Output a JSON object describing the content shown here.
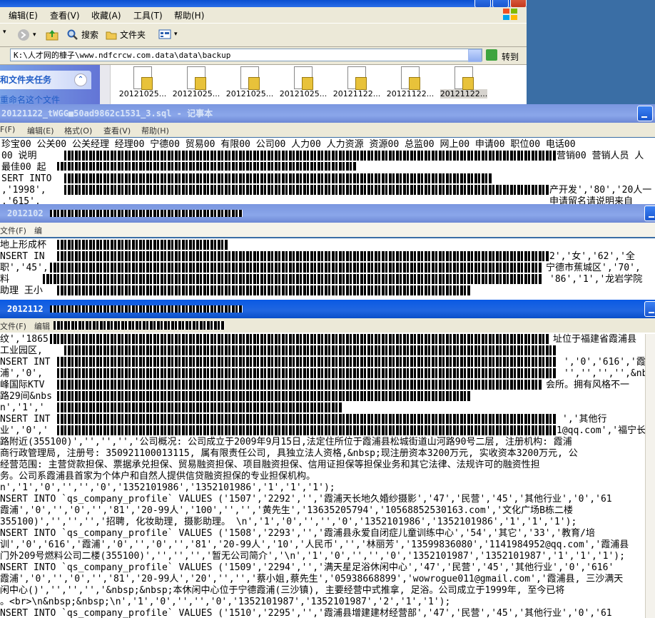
{
  "explorer": {
    "menu": [
      "编辑(E)",
      "查看(V)",
      "收藏(A)",
      "工具(T)",
      "帮助(H)"
    ],
    "toolbar": {
      "search": "搜索",
      "folders": "文件夹"
    },
    "address": "K:\\人才网的槺子\\www.ndfcrcw.com.data\\data\\backup",
    "go": "转到",
    "task_header": "和文件夹任务",
    "task_link": "重命名这个文件",
    "files": [
      "20121025...",
      "20121025...",
      "20121025...",
      "20121025...",
      "20121122...",
      "20121122...",
      "20121122..."
    ]
  },
  "notepad1": {
    "title": "20121122_tWGG■50ad9862c1531_3.sql - 记事本",
    "menu": [
      "F(F)",
      "编辑(E)",
      "格式(O)",
      "查看(V)",
      "帮助(H)"
    ],
    "lines": [
      "珍宝00 公关00 公关经理 经理00 宁德00 贸易00 有限00 公司00 人力00 人力资源 资源00 总监00 网上00 申请00 职位00 电话00",
      "00 说明",
      "最佳00 起",
      "SERT INTO",
      ",'1998',",
      ",'615',"
    ],
    "right_lines": [
      "营销00 营销人员 人",
      "",
      "",
      "",
      "产开发','80','20人一",
      "申请留名请说明来自"
    ]
  },
  "notepad2": {
    "title": "2012102",
    "menu": [
      "文件(F)",
      "编"
    ],
    "lines": [
      "地上形成杯",
      "NSERT IN",
      "职','45',",
      "料",
      "助理 王小"
    ],
    "right_lines": [
      "",
      "2','女','62','全",
      "宁德市蕉城区','70',",
      "'86','1','龙岩学院",
      ""
    ]
  },
  "notepad3": {
    "title": "2012112",
    "menu": [
      "文件(F)",
      "编辑"
    ],
    "lines": [
      "纹','1865",
      "工业园区,",
      "NSERT INT",
      "浦','0',",
      "峰国际KTV",
      "路29间&nbs",
      "n','1','",
      "NSERT INT",
      "业','0','",
      "路附近(355100)','','','','公司概况: 公司成立于2009年9月15日,法定住所位于霞浦县松城街道山河路90号二层, 注册机构: 霞浦",
      "商行政管理局, 注册号: 350921100013115, 属有限责任公司, 具独立法人资格,&nbsp;现注册资本3200万元, 实收资本3200万元, 公",
      "经营范围: 主营贷款担保、票据承兑担保、贸易融资担保、项目融资担保、信用证担保等担保业务和其它法律、法规许可的融资性担",
      "务。公司系霞浦县首家为个体户和自然人提供信贷融资担保的专业担保机构。",
      "n','1','0','','','0','1352101986','1352101986','1','1','1');",
      "NSERT INTO `qs_company_profile` VALUES ('1507','2292','','霞浦天长地久婚纱摄影','47','民营','45','其他行业','0','61",
      "霞浦','0','','0','','81','20-99人','100','','','黄先生','13635205794','10568852530163.com','文化广场B栋二楼",
      "355100)','','','','招聘, 化妆助理, 摄影助理。 \\n','1','0','','','0','1352101986','1352101986','1','1','1');",
      "NSERT INTO `qs_company_profile` VALUES ('1508','2293','','霞浦县永爱自闭症儿童训练中心','54','其它','33','教育/培",
      "训','0','616','霞浦','0','','0','','81','20-99人','10','人民币','','林丽芳','13599836080','1141984952@qq.com','霞浦县",
      "门外209号燃料公司二楼(355100)','','','','暂无公司简介','\\n','1','0','','','0','1352101987','1352101987','1','1','1');",
      "NSERT INTO `qs_company_profile` VALUES ('1509','2294','','满天星足浴休闲中心','47','民营','45','其他行业','0','616'",
      "霞浦','0','','0','','81','20-99人','20','','','蔡小姐,蔡先生','05938668899','wowrogue011@gmail.com','霞浦县, 三沙满天",
      "闲中心()','','','','&nbsp;&nbsp;本休闲中心位于宁德霞浦(三沙镇), 主要经营中式推拿, 足浴。公司成立于1999年, 至今已将",
      "。<br>\\n&nbsp;&nbsp;\\n','1','0','','','0','1352101987','1352101987','2','1','1');",
      "NSERT INTO `qs_company_profile` VALUES ('1510','2295','','霞浦县增建建材经营部','47','民营','45','其他行业','0','61"
    ],
    "right_lines": [
      "址位于福建省霞浦县",
      "",
      "','0','616','霞",
      "'','','','',&nbs",
      "会所。拥有风格不一",
      "",
      "",
      "','其他行",
      "1@qq.com','福宁长途"
    ]
  }
}
